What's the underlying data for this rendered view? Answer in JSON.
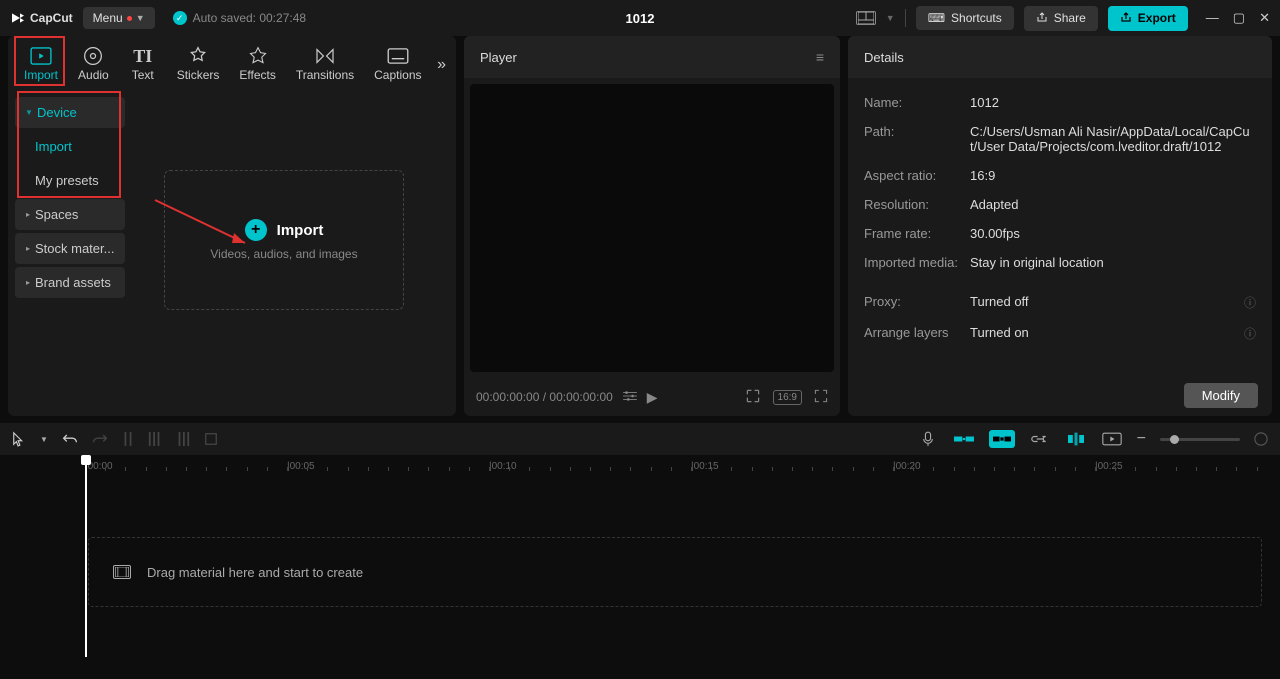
{
  "titlebar": {
    "app_name": "CapCut",
    "menu_label": "Menu",
    "autosave": "Auto saved: 00:27:48",
    "project_title": "1012",
    "shortcuts": "Shortcuts",
    "share": "Share",
    "export": "Export"
  },
  "tabs": {
    "import": "Import",
    "audio": "Audio",
    "text": "Text",
    "stickers": "Stickers",
    "effects": "Effects",
    "transitions": "Transitions",
    "captions": "Captions"
  },
  "sidebar": {
    "device": "Device",
    "import": "Import",
    "my_presets": "My presets",
    "spaces": "Spaces",
    "stock": "Stock mater...",
    "brand": "Brand assets"
  },
  "import_box": {
    "label": "Import",
    "sub": "Videos, audios, and images"
  },
  "player": {
    "title": "Player",
    "time": "00:00:00:00 / 00:00:00:00",
    "ratio_badge": "16:9"
  },
  "details": {
    "title": "Details",
    "name_label": "Name:",
    "name_value": "1012",
    "path_label": "Path:",
    "path_value": "C:/Users/Usman Ali Nasir/AppData/Local/CapCut/User Data/Projects/com.lveditor.draft/1012",
    "aspect_label": "Aspect ratio:",
    "aspect_value": "16:9",
    "resolution_label": "Resolution:",
    "resolution_value": "Adapted",
    "framerate_label": "Frame rate:",
    "framerate_value": "30.00fps",
    "imported_label": "Imported media:",
    "imported_value": "Stay in original location",
    "proxy_label": "Proxy:",
    "proxy_value": "Turned off",
    "arrange_label": "Arrange layers",
    "arrange_value": "Turned on",
    "modify": "Modify"
  },
  "timeline": {
    "ticks": [
      "|00:00",
      "|00:05",
      "|00:10",
      "|00:15",
      "|00:20",
      "|00:25"
    ],
    "drop_hint": "Drag material here and start to create"
  }
}
